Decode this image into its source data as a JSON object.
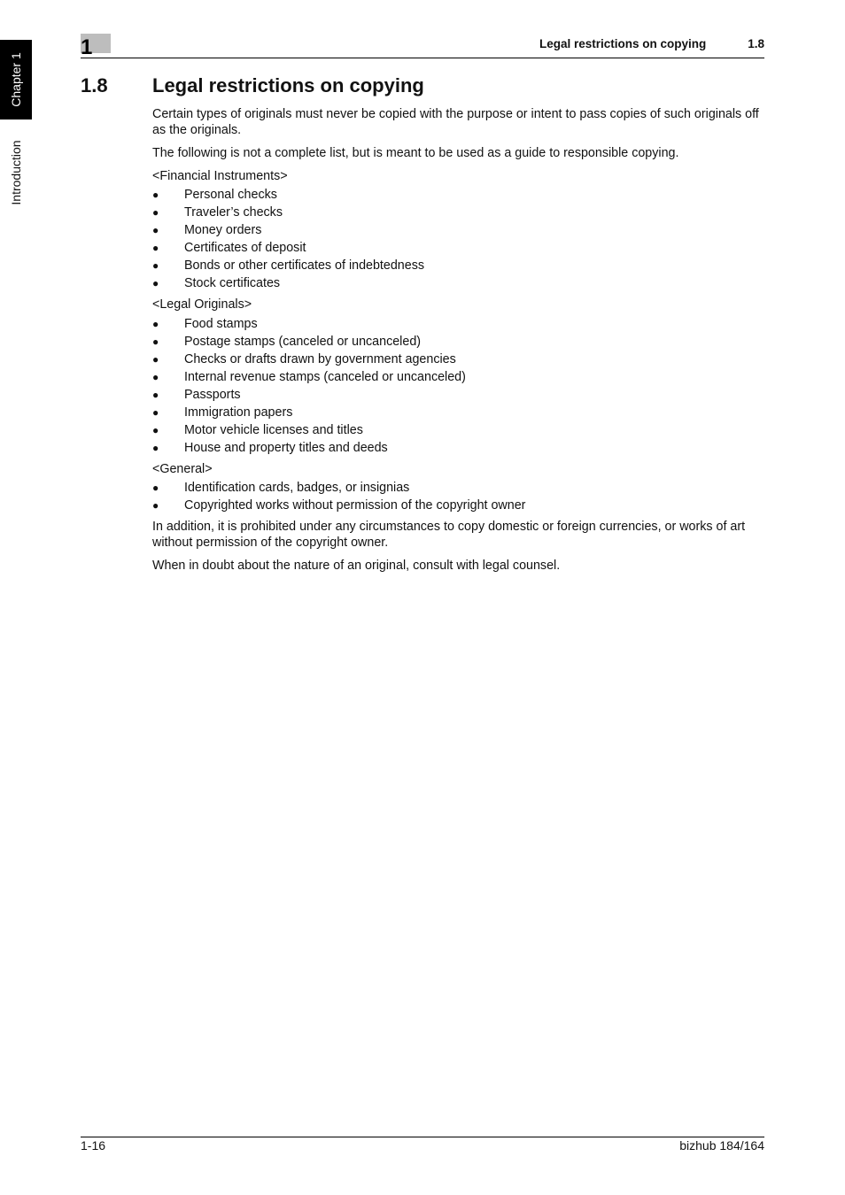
{
  "side": {
    "chapter_tab": "Chapter 1",
    "section_label": "Introduction"
  },
  "header": {
    "chapter_number": "1",
    "running_title": "Legal restrictions on copying",
    "section_number": "1.8"
  },
  "section": {
    "number": "1.8",
    "title": "Legal restrictions on copying"
  },
  "body": {
    "intro": [
      "Certain types of originals must never be copied with the purpose or intent to pass copies of such originals off as the originals.",
      "The following is not a complete list, but is meant to be used as a guide to responsible copying."
    ],
    "bullet_glyph": "●",
    "categories": [
      {
        "label": "<Financial Instruments>",
        "items": [
          "Personal checks",
          "Traveler’s checks",
          "Money orders",
          "Certificates of deposit",
          "Bonds or other certificates of indebtedness",
          "Stock certificates"
        ]
      },
      {
        "label": "<Legal Originals>",
        "items": [
          "Food stamps",
          "Postage stamps (canceled or uncanceled)",
          "Checks or drafts drawn by government agencies",
          "Internal revenue stamps (canceled or uncanceled)",
          "Passports",
          "Immigration papers",
          "Motor vehicle licenses and titles",
          "House and property titles and deeds"
        ]
      },
      {
        "label": "<General>",
        "items": [
          "Identification cards, badges, or insignias",
          "Copyrighted works without permission of the copyright owner"
        ]
      }
    ],
    "closing": [
      "In addition, it is prohibited under any circumstances to copy domestic or foreign currencies, or works of art without permission of the copyright owner.",
      "When in doubt about the nature of an original, consult with legal counsel."
    ]
  },
  "footer": {
    "page_number": "1-16",
    "model": "bizhub 184/164"
  }
}
